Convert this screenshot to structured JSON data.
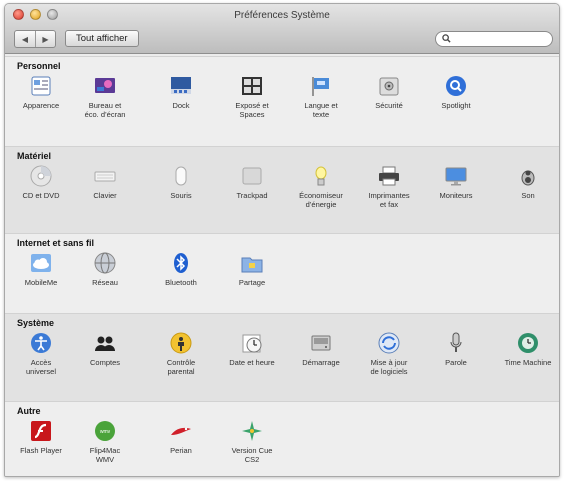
{
  "window": {
    "title": "Préférences Système"
  },
  "toolbar": {
    "back": "◀",
    "forward": "▶",
    "show_all": "Tout afficher"
  },
  "search": {
    "value": "",
    "placeholder": ""
  },
  "sections": [
    {
      "title": "Personnel",
      "items": [
        {
          "label": "Apparence",
          "icon": "appearance-icon"
        },
        {
          "label": "Bureau et\néco. d’écran",
          "icon": "desktop-icon"
        },
        {
          "label": "Dock",
          "icon": "dock-icon"
        },
        {
          "label": "Exposé et\nSpaces",
          "icon": "expose-icon"
        },
        {
          "label": "Langue et\ntexte",
          "icon": "language-icon"
        },
        {
          "label": "Sécurité",
          "icon": "security-icon"
        },
        {
          "label": "Spotlight",
          "icon": "spotlight-icon"
        }
      ]
    },
    {
      "title": "Matériel",
      "items": [
        {
          "label": "CD et DVD",
          "icon": "cd-icon"
        },
        {
          "label": "Clavier",
          "icon": "keyboard-icon"
        },
        {
          "label": "Souris",
          "icon": "mouse-icon"
        },
        {
          "label": "Trackpad",
          "icon": "trackpad-icon"
        },
        {
          "label": "Économiseur\nd’énergie",
          "icon": "energy-icon"
        },
        {
          "label": "Imprimantes\net fax",
          "icon": "printer-icon"
        },
        {
          "label": "Moniteurs",
          "icon": "display-icon"
        },
        {
          "label": "Son",
          "icon": "sound-icon"
        }
      ]
    },
    {
      "title": "Internet et sans fil",
      "items": [
        {
          "label": "MobileMe",
          "icon": "mobileme-icon"
        },
        {
          "label": "Réseau",
          "icon": "network-icon"
        },
        {
          "label": "Bluetooth",
          "icon": "bluetooth-icon"
        },
        {
          "label": "Partage",
          "icon": "sharing-icon"
        }
      ]
    },
    {
      "title": "Système",
      "items": [
        {
          "label": "Accès\nuniversel",
          "icon": "accessibility-icon"
        },
        {
          "label": "Comptes",
          "icon": "accounts-icon"
        },
        {
          "label": "Contrôle\nparental",
          "icon": "parental-icon"
        },
        {
          "label": "Date et heure",
          "icon": "date-time-icon"
        },
        {
          "label": "Démarrage",
          "icon": "startup-icon"
        },
        {
          "label": "Mise à jour\nde logiciels",
          "icon": "software-update-icon"
        },
        {
          "label": "Parole",
          "icon": "speech-icon"
        },
        {
          "label": "Time Machine",
          "icon": "time-machine-icon"
        }
      ]
    },
    {
      "title": "Autre",
      "items": [
        {
          "label": "Flash Player",
          "icon": "flash-icon"
        },
        {
          "label": "Flip4Mac\nWMV",
          "icon": "flip4mac-icon"
        },
        {
          "label": "Perian",
          "icon": "perian-icon"
        },
        {
          "label": "Version Cue\nCS2",
          "icon": "version-cue-icon"
        }
      ]
    }
  ]
}
